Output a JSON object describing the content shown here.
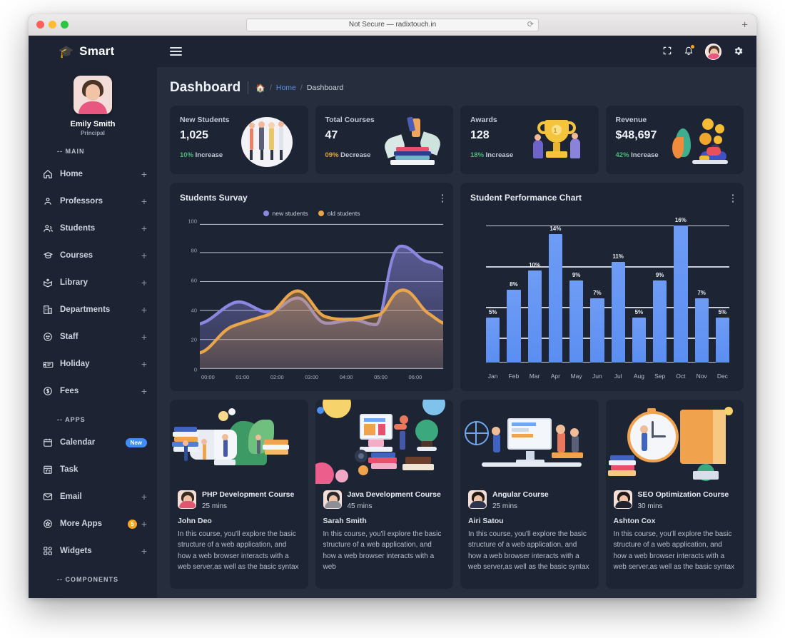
{
  "browser": {
    "url_text": "Not Secure — radixtouch.in",
    "reload_icon": "reload-icon",
    "newtab_icon": "plus-icon"
  },
  "sidebar": {
    "brand": {
      "logo_icon": "graduation-cap-icon",
      "name": "Smart"
    },
    "profile": {
      "name": "Emily Smith",
      "role": "Principal",
      "avatar_icon": "user-avatar"
    },
    "sections": [
      {
        "label": "-- MAIN",
        "items": [
          {
            "label": "Home",
            "icon": "home-icon",
            "plus": "+"
          },
          {
            "label": "Professors",
            "icon": "user-icon",
            "plus": "+"
          },
          {
            "label": "Students",
            "icon": "users-icon",
            "plus": "+"
          },
          {
            "label": "Courses",
            "icon": "graduation-cap-icon",
            "plus": "+"
          },
          {
            "label": "Library",
            "icon": "book-open-icon",
            "plus": "+"
          },
          {
            "label": "Departments",
            "icon": "building-icon",
            "plus": "+"
          },
          {
            "label": "Staff",
            "icon": "staff-face-icon",
            "plus": "+"
          },
          {
            "label": "Holiday",
            "icon": "holiday-icon",
            "plus": "+"
          },
          {
            "label": "Fees",
            "icon": "dollar-circle-icon",
            "plus": "+"
          }
        ]
      },
      {
        "label": "-- APPS",
        "items": [
          {
            "label": "Calendar",
            "icon": "calendar-icon",
            "badge": "New"
          },
          {
            "label": "Task",
            "icon": "task-list-icon"
          },
          {
            "label": "Email",
            "icon": "envelope-icon",
            "plus": "+"
          },
          {
            "label": "More Apps",
            "icon": "apps-star-icon",
            "count": "5",
            "plus": "+"
          },
          {
            "label": "Widgets",
            "icon": "widgets-icon",
            "plus": "+"
          }
        ]
      },
      {
        "label": "-- COMPONENTS",
        "items": []
      }
    ]
  },
  "topbar": {
    "menu_icon": "hamburger-icon",
    "fullscreen_icon": "fullscreen-icon",
    "notification_icon": "bell-icon",
    "avatar_icon": "user-avatar",
    "settings_icon": "gear-icon"
  },
  "page": {
    "title": "Dashboard",
    "breadcrumb": {
      "home_icon": "home-icon",
      "sep": "/",
      "home": "Home",
      "current": "Dashboard"
    }
  },
  "stats": [
    {
      "label": "New Students",
      "value": "1,025",
      "delta": "10%",
      "delta_text": "Increase",
      "direction": "up",
      "art": "students-group-illustration"
    },
    {
      "label": "Total Courses",
      "value": "47",
      "delta": "09%",
      "delta_text": "Decrease",
      "direction": "down",
      "art": "books-stack-illustration"
    },
    {
      "label": "Awards",
      "value": "128",
      "delta": "18%",
      "delta_text": "Increase",
      "direction": "up",
      "art": "trophy-illustration"
    },
    {
      "label": "Revenue",
      "value": "$48,697",
      "delta": "42%",
      "delta_text": "Increase",
      "direction": "up",
      "art": "coins-person-illustration"
    }
  ],
  "colors": {
    "accent_blue": "#5b8ef2",
    "new_students": "#8b86e0",
    "old_students": "#e8a54b",
    "increase": "#46b87a",
    "decrease": "#e0a33c",
    "sidebar_bg": "#1d2332",
    "card_bg": "#1d2433",
    "page_bg": "#262d3c"
  },
  "chart_data": [
    {
      "type": "area",
      "title": "Students Survay",
      "menu_icon": "kebab-menu-icon",
      "legend": [
        "new students",
        "old students"
      ],
      "legend_position": "top-center",
      "x": [
        "00:00",
        "01:00",
        "02:00",
        "03:00",
        "04:00",
        "05:00",
        "06:00"
      ],
      "xlabel": "",
      "ylabel": "",
      "ylim": [
        0,
        100
      ],
      "yticks": [
        0,
        20,
        40,
        60,
        80,
        100
      ],
      "grid": true,
      "series": [
        {
          "name": "new students",
          "color": "#8b86e0",
          "values": [
            31,
            39,
            30,
            51,
            43,
            84,
            77
          ]
        },
        {
          "name": "old students",
          "color": "#e8a54b",
          "values": [
            11,
            31,
            44,
            33,
            34,
            52,
            41
          ]
        }
      ]
    },
    {
      "type": "bar",
      "title": "Student Performance Chart",
      "menu_icon": "kebab-menu-icon",
      "categories": [
        "Jan",
        "Feb",
        "Mar",
        "Apr",
        "May",
        "Jun",
        "Jul",
        "Aug",
        "Sep",
        "Oct",
        "Nov",
        "Dec"
      ],
      "values": [
        5,
        8,
        10,
        14,
        9,
        7,
        11,
        5,
        9,
        16,
        7,
        5
      ],
      "value_labels": [
        "5%",
        "8%",
        "10%",
        "14%",
        "9%",
        "7%",
        "11%",
        "5%",
        "9%",
        "16%",
        "7%",
        "5%"
      ],
      "xlabel": "",
      "ylabel": "",
      "ylim": [
        0,
        16
      ],
      "grid": true,
      "bar_color": "#5b8ef2"
    }
  ],
  "courses": [
    {
      "thumb": "books-reading-illustration",
      "title": "PHP Development Course",
      "duration": "25 mins",
      "author": "John Deo",
      "author_avatar": "author-avatar",
      "description": "In this course, you'll explore the basic structure of a web application, and how a web browser interacts with a web server,as well as the basic syntax"
    },
    {
      "thumb": "desk-computer-illustration",
      "title": "Java Development Course",
      "duration": "45 mins",
      "author": "Sarah Smith",
      "author_avatar": "author-avatar",
      "description": "In this course, you'll explore the basic structure of a web application, and how a web browser interacts with a web"
    },
    {
      "thumb": "online-learning-illustration",
      "title": "Angular Course",
      "duration": "25 mins",
      "author": "Airi Satou",
      "author_avatar": "author-avatar",
      "description": "In this course, you'll explore the basic structure of a web application, and how a web browser interacts with a web server,as well as the basic syntax"
    },
    {
      "thumb": "time-management-illustration",
      "title": "SEO Optimization Course",
      "duration": "30 mins",
      "author": "Ashton Cox",
      "author_avatar": "author-avatar",
      "description": "In this course, you'll explore the basic structure of a web application, and how a web browser interacts with a web server,as well as the basic syntax"
    }
  ]
}
